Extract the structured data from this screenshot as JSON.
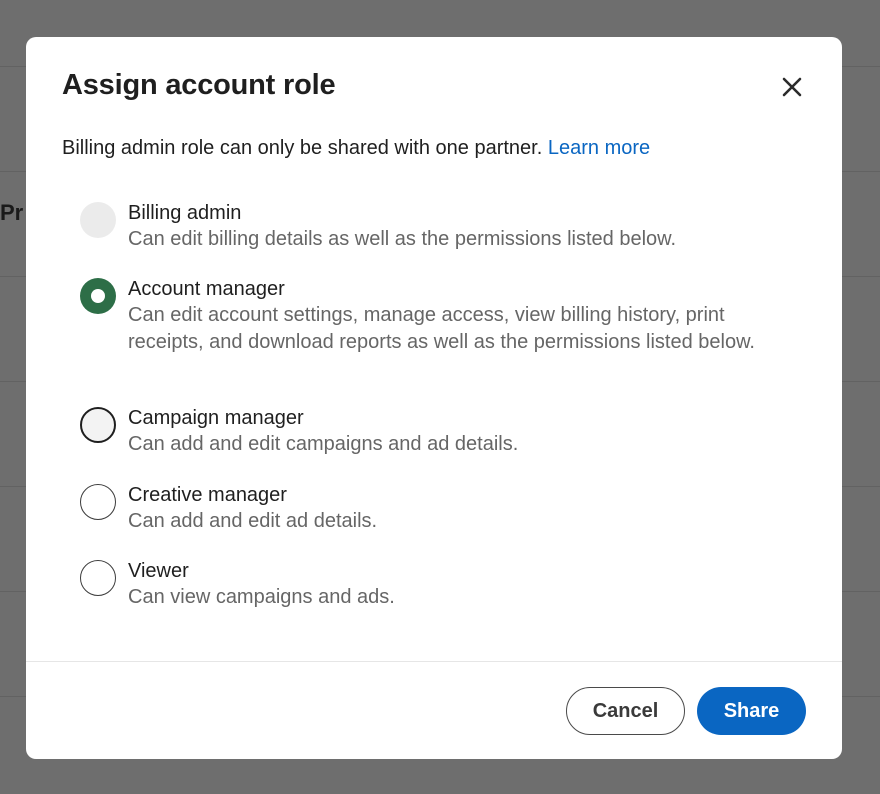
{
  "background": {
    "title_fragment": "Pr"
  },
  "modal": {
    "title": "Assign account role",
    "close_icon": "close-icon",
    "notice_text": "Billing admin role can only be shared with one partner.",
    "learn_more_label": "Learn more",
    "roles": [
      {
        "label": "Billing admin",
        "description": "Can edit billing details as well as the permissions listed below.",
        "state": "disabled"
      },
      {
        "label": "Account manager",
        "description": "Can edit account settings, manage access, view billing history, print receipts, and download reports as well as the permissions listed below.",
        "state": "selected"
      },
      {
        "label": "Campaign manager",
        "description": "Can add and edit campaigns and ad details.",
        "state": "focused"
      },
      {
        "label": "Creative manager",
        "description": "Can add and edit ad details.",
        "state": "unselected"
      },
      {
        "label": "Viewer",
        "description": "Can view campaigns and ads.",
        "state": "unselected"
      }
    ],
    "cancel_label": "Cancel",
    "share_label": "Share"
  },
  "colors": {
    "accent": "#0a66c2",
    "selected_radio": "#2d6e47",
    "overlay": "#6e6e6e"
  }
}
